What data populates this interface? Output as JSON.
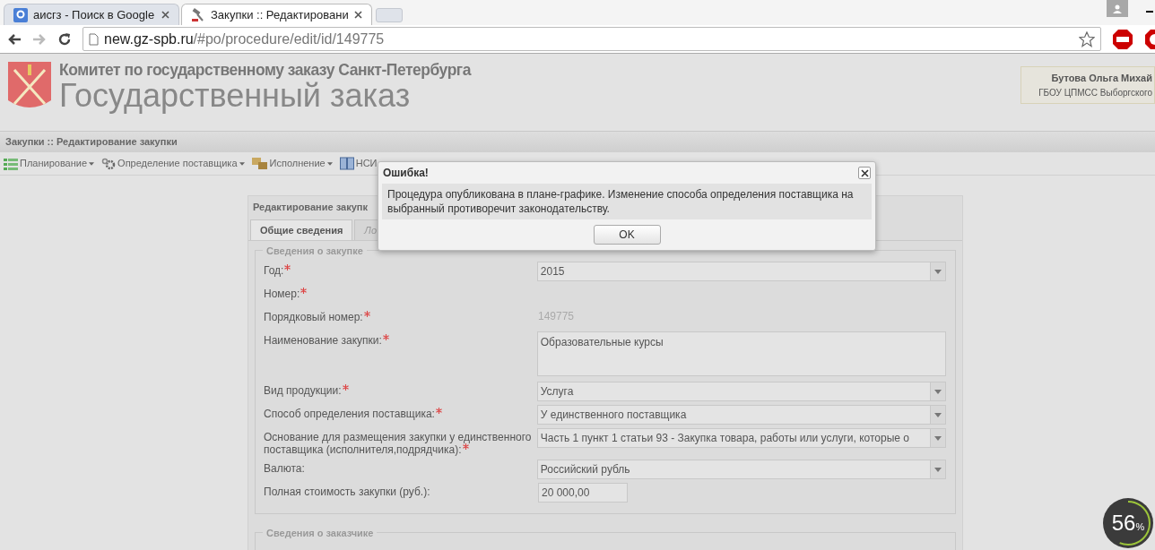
{
  "browser": {
    "tabs": [
      {
        "title": "аисгз - Поиск в Google",
        "selected": false
      },
      {
        "title": "Закупки :: Редактировани",
        "selected": true
      }
    ],
    "url_host": "new.gz-spb.ru",
    "url_path": "/#po/procedure/edit/id/149775"
  },
  "header": {
    "subtitle": "Комитет по государственному заказу Санкт-Петербурга",
    "title": "Государственный заказ",
    "user_name": "Бутова Ольга Михай",
    "user_org": "ГБОУ ЦПМСС Выборгского"
  },
  "page_title": "Закупки :: Редактирование закупки",
  "menu": [
    {
      "label": "Планирование"
    },
    {
      "label": "Определение поставщика"
    },
    {
      "label": "Исполнение"
    },
    {
      "label": "НСИ"
    }
  ],
  "panel": {
    "title": "Редактирование закупк",
    "tabs": [
      {
        "label": "Общие сведения",
        "selected": true
      },
      {
        "label": "Ло",
        "selected": false
      }
    ],
    "section": "Сведения о закупке",
    "fields": [
      {
        "label": "Год:",
        "required": true,
        "kind": "select",
        "value": "2015"
      },
      {
        "label": "Номер:",
        "required": true,
        "kind": "static"
      },
      {
        "label": "Порядковый номер:",
        "required": true,
        "kind": "static",
        "value": "149775"
      },
      {
        "label": "Наименование закупки:",
        "required": true,
        "kind": "textarea",
        "value": "Образовательные курсы"
      },
      {
        "label": "Вид продукции:",
        "required": true,
        "kind": "select",
        "value": "Услуга"
      },
      {
        "label": "Способ определения поставщика:",
        "required": true,
        "kind": "select",
        "value": "У единственного поставщика"
      },
      {
        "label": "Основание для размещения закупки у единственного поставщика (исполнителя,подрядчика):",
        "required": true,
        "kind": "select",
        "value": "Часть 1 пункт 1 статьи 93 -  Закупка товара, работы или услуги, которые о"
      },
      {
        "label": "Валюта:",
        "required": false,
        "kind": "select",
        "value": "Российский рубль"
      },
      {
        "label": "Полная стоимость закупки (руб.):",
        "required": false,
        "kind": "input",
        "value": "20 000,00"
      }
    ],
    "section2": "Сведения о заказчике"
  },
  "dialog": {
    "title": "Ошибка!",
    "message": "Процедура опубликована в плане-графике. Изменение способа определения поставщика на выбранный противоречит законодательству.",
    "button": "OK"
  },
  "gauge": {
    "value": "56",
    "unit": "%"
  }
}
